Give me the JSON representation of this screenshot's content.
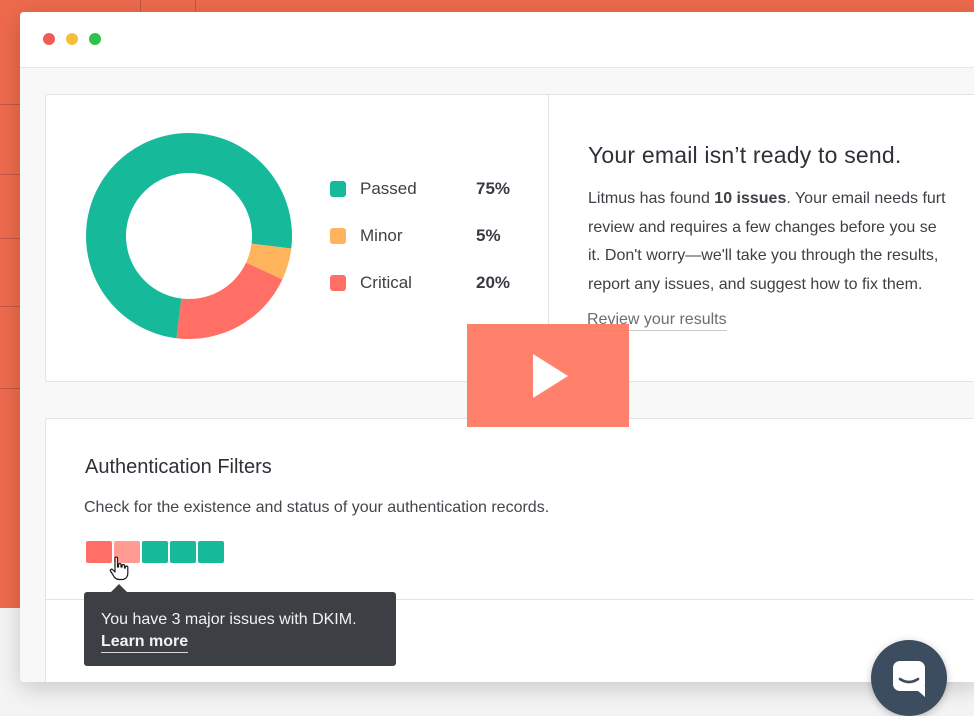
{
  "window": {
    "controls": [
      "close",
      "minimize",
      "maximize"
    ]
  },
  "summary": {
    "legend": [
      {
        "label": "Passed",
        "percent": "75%",
        "value": 75,
        "color": "#17b99b"
      },
      {
        "label": "Minor",
        "percent": "5%",
        "value": 5,
        "color": "#ffb35c"
      },
      {
        "label": "Critical",
        "percent": "20%",
        "value": 20,
        "color": "#ff6f66"
      }
    ],
    "headline": "Your email isn’t ready to send.",
    "para": {
      "line1_pre": "Litmus has found ",
      "issues_bold": "10 issues",
      "line1_post": ". Your email needs furt",
      "line2": "review and requires a few changes before you se",
      "line3": "it. Don't worry—we'll take you through the results,",
      "line4": "report any issues, and suggest how to fix them."
    },
    "review_link": "Review your results"
  },
  "auth": {
    "title": "Authentication Filters",
    "subtitle": "Check for the existence and status of your authentication records.",
    "segments": [
      {
        "status": "critical",
        "color": "#ff6f66"
      },
      {
        "status": "critical-hover",
        "color": "#ff9b92"
      },
      {
        "status": "passed",
        "color": "#17b99b"
      },
      {
        "status": "passed",
        "color": "#17b99b"
      },
      {
        "status": "passed",
        "color": "#17b99b"
      }
    ]
  },
  "tooltip": {
    "text": "You have 3 major issues with DKIM.",
    "link": "Learn more"
  },
  "icons": {
    "play": "play-icon",
    "chat": "chat-icon",
    "cursor": "hand-pointer-icon"
  },
  "colors": {
    "background": "#ee6a4d",
    "play_overlay": "#ff7660",
    "chat_button": "#3c4d5f"
  }
}
